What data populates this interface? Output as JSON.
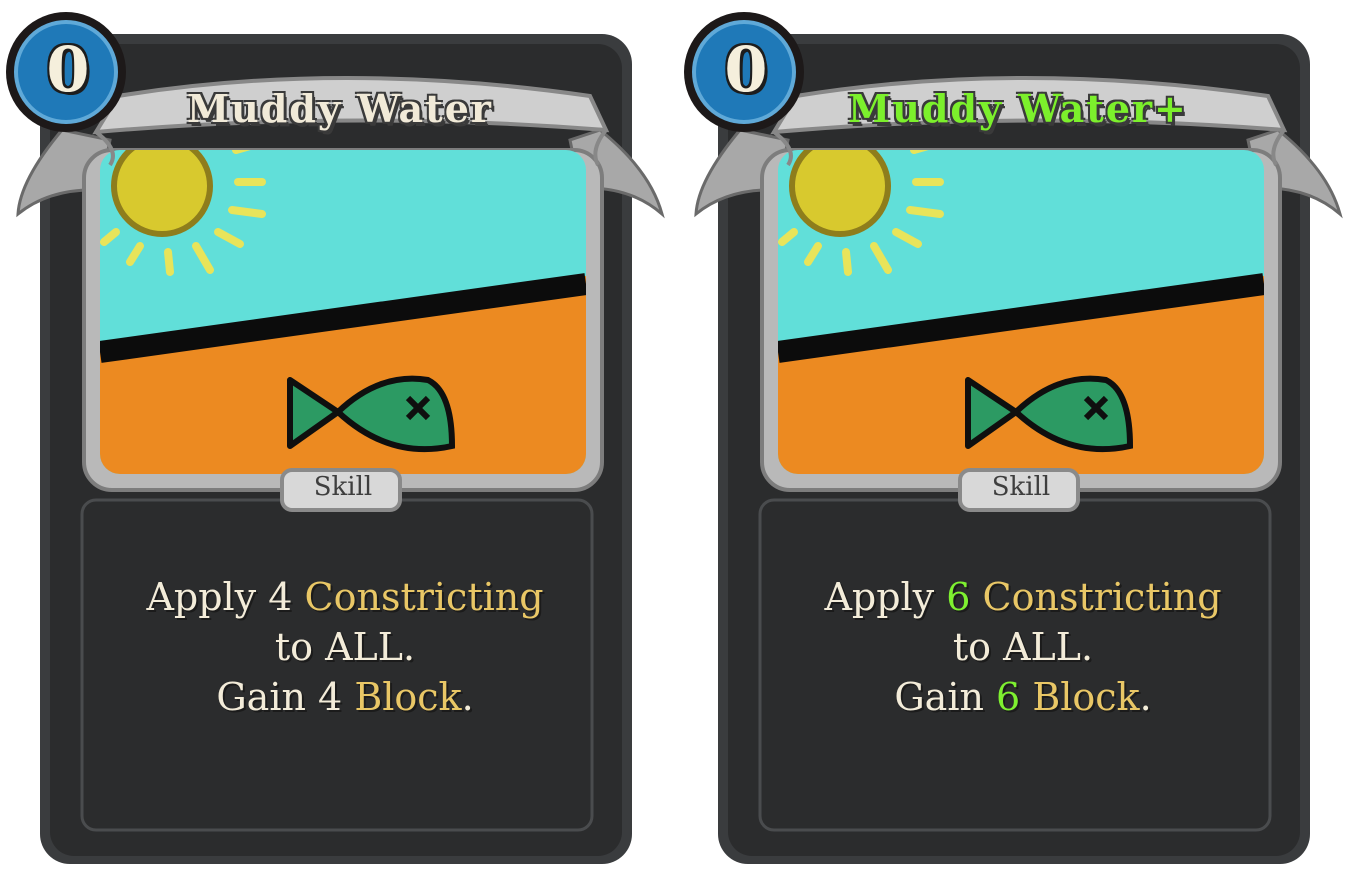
{
  "cards": [
    {
      "cost": "0",
      "title": "Muddy Water",
      "type": "Skill",
      "desc": {
        "line1_a": "Apply ",
        "line1_num": "4",
        "line1_kw": "Constricting",
        "line2": "to ALL.",
        "line3_a": "Gain ",
        "line3_num": "4",
        "line3_kw": "Block",
        "line3_end": "."
      }
    },
    {
      "cost": "0",
      "title": "Muddy Water+",
      "type": "Skill",
      "desc": {
        "line1_a": "Apply ",
        "line1_num": "6",
        "line1_kw": "Constricting",
        "line2": "to ALL.",
        "line3_a": "Gain ",
        "line3_num": "6",
        "line3_kw": "Block",
        "line3_end": "."
      }
    }
  ],
  "colors": {
    "card_body": "#2b2c2d",
    "frame": "#3b3d3e",
    "banner": "#c4c4c4",
    "sky": "#61dfd9",
    "sand": "#ec8a21",
    "sun": "#d8c92e",
    "fish": "#2c9a63",
    "cost_orb": "#1f79b8",
    "keyword": "#e9c766",
    "upgrade": "#7cf02c"
  },
  "icons": [
    "energy-orb-icon",
    "sun-icon",
    "fish-icon"
  ]
}
